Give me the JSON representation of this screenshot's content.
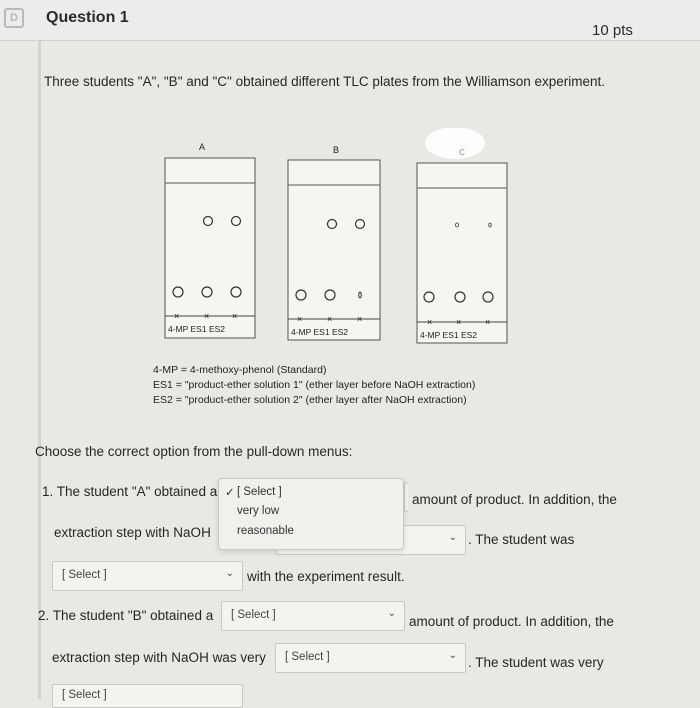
{
  "header": {
    "icon": "D",
    "title": "Question 1",
    "points": "10 pts"
  },
  "intro": "Three students \"A\", \"B\" and \"C\" obtained different TLC plates from the Williamson experiment.",
  "plates": [
    {
      "label": "A",
      "lanes": "4-MP  ES1  ES2"
    },
    {
      "label": "B",
      "lanes": "4-MP  ES1  ES2"
    },
    {
      "label": "C",
      "lanes": "4-MP  ES1  ES2"
    }
  ],
  "legend": [
    "4-MP = 4-methoxy-phenol (Standard)",
    "ES1 = \"product-ether solution 1\" (ether layer before NaOH extraction)",
    "ES2 = \"product-ether solution 2\" (ether layer after NaOH extraction)"
  ],
  "prompt": "Choose the correct option from the pull-down menus:",
  "q1": {
    "part1": "1. The student \"A\" obtained a",
    "part2": "amount of product. In addition, the",
    "part3": "extraction step with NaOH",
    "part4": ". The student was",
    "part5": "with the experiment result.",
    "dropdown_options": [
      "[ Select ]",
      "very low",
      "reasonable"
    ],
    "dropdown_check": "✓",
    "select_placeholder": "[ Select ]"
  },
  "q2": {
    "part1": "2. The student \"B\" obtained a",
    "part2": "amount of product. In addition, the",
    "part3": "extraction step with NaOH was very",
    "part4": ". The student was very",
    "select_placeholder": "[ Select ]"
  },
  "q3_cut": "[ Select ]",
  "icons": {
    "chevron": "chevron-down-icon",
    "check": "checkmark-icon"
  },
  "colors": {
    "background": "#e9e8e4",
    "border": "#c9c8c4",
    "text": "#262626"
  }
}
